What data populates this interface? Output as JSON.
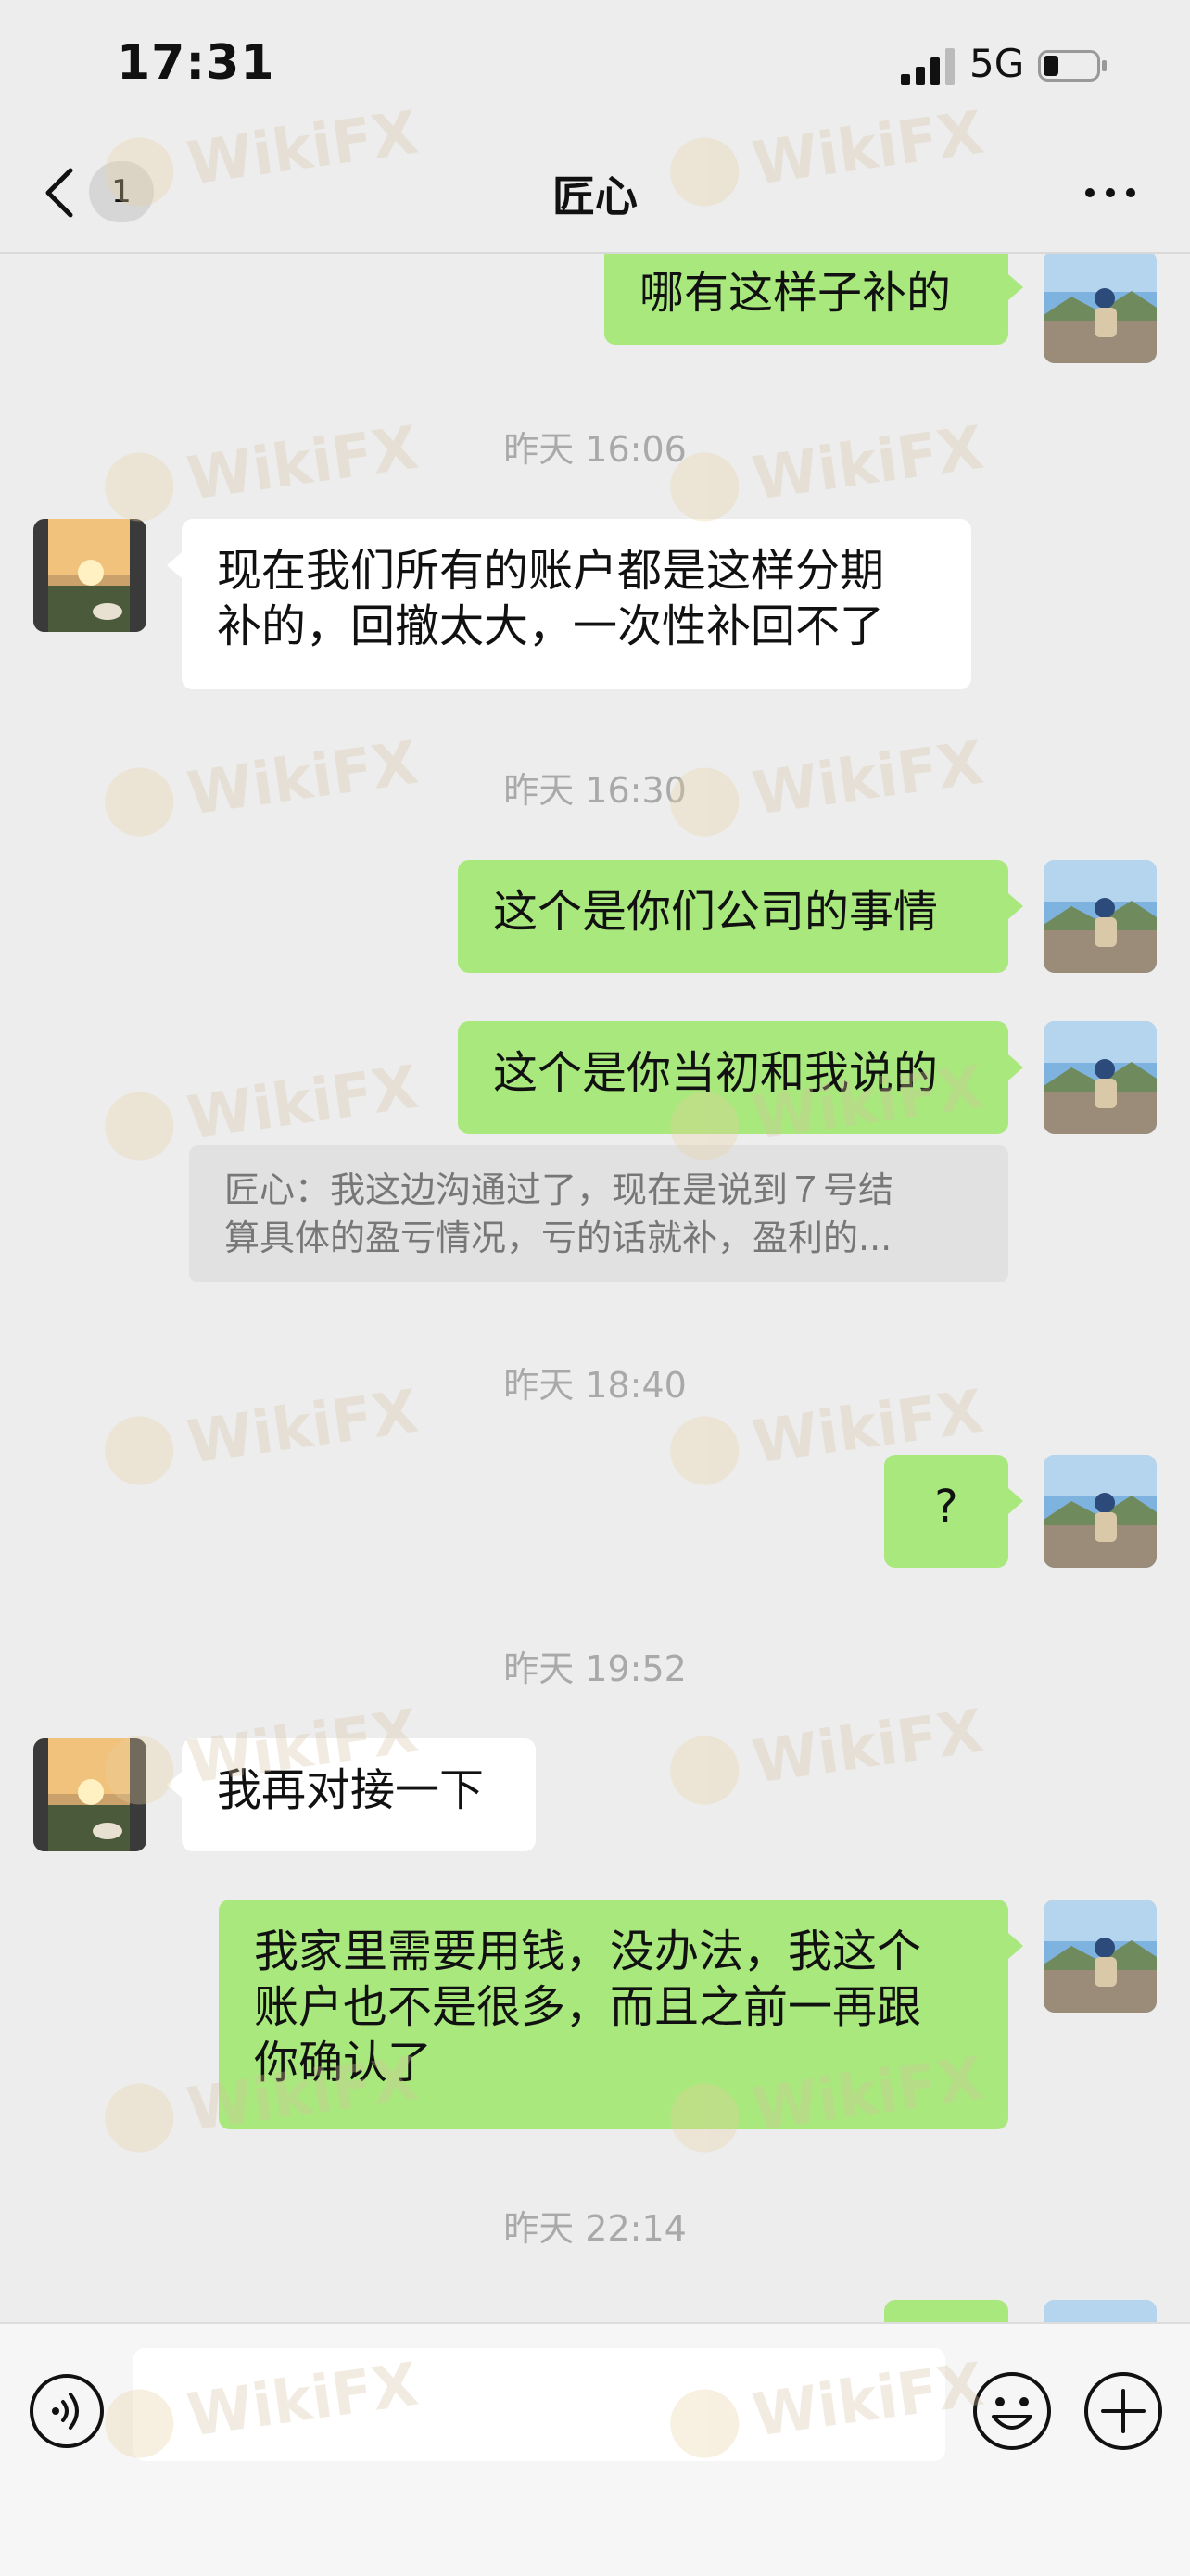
{
  "status_bar": {
    "time": "17:31",
    "network": "5G"
  },
  "nav": {
    "unread_count": "1",
    "title": "匠心"
  },
  "messages": {
    "m1": {
      "text": "哪有这样子补的"
    },
    "ts1": "昨天 16:06",
    "m2": {
      "line1": "现在我们所有的账户都是这样分期",
      "line2": "补的，回撤太大，一次性补回不了"
    },
    "ts2": "昨天 16:30",
    "m3": {
      "text": "这个是你们公司的事情"
    },
    "m4": {
      "text": "这个是你当初和我说的"
    },
    "quote": {
      "line1": "匠心：我这边沟通过了，现在是说到７号结",
      "line2": "算具体的盈亏情况，亏的话就补，盈利的..."
    },
    "ts3": "昨天 18:40",
    "m5": {
      "text": "?"
    },
    "ts4": "昨天 19:52",
    "m6": {
      "text": "我再对接一下"
    },
    "m7": {
      "line1": "我家里需要用钱，没办法，我这个",
      "line2": "账户也不是很多，而且之前一再跟",
      "line3": "你确认了"
    },
    "ts5": "昨天 22:14"
  },
  "watermark": {
    "text": "WikiFX"
  },
  "colors": {
    "outgoing_bubble": "#a8e87c",
    "incoming_bubble": "#ffffff",
    "background": "#ededed"
  },
  "icons": [
    "back-icon",
    "more-icon",
    "voice-icon",
    "emoji-icon",
    "plus-icon",
    "signal-icon",
    "battery-icon"
  ]
}
